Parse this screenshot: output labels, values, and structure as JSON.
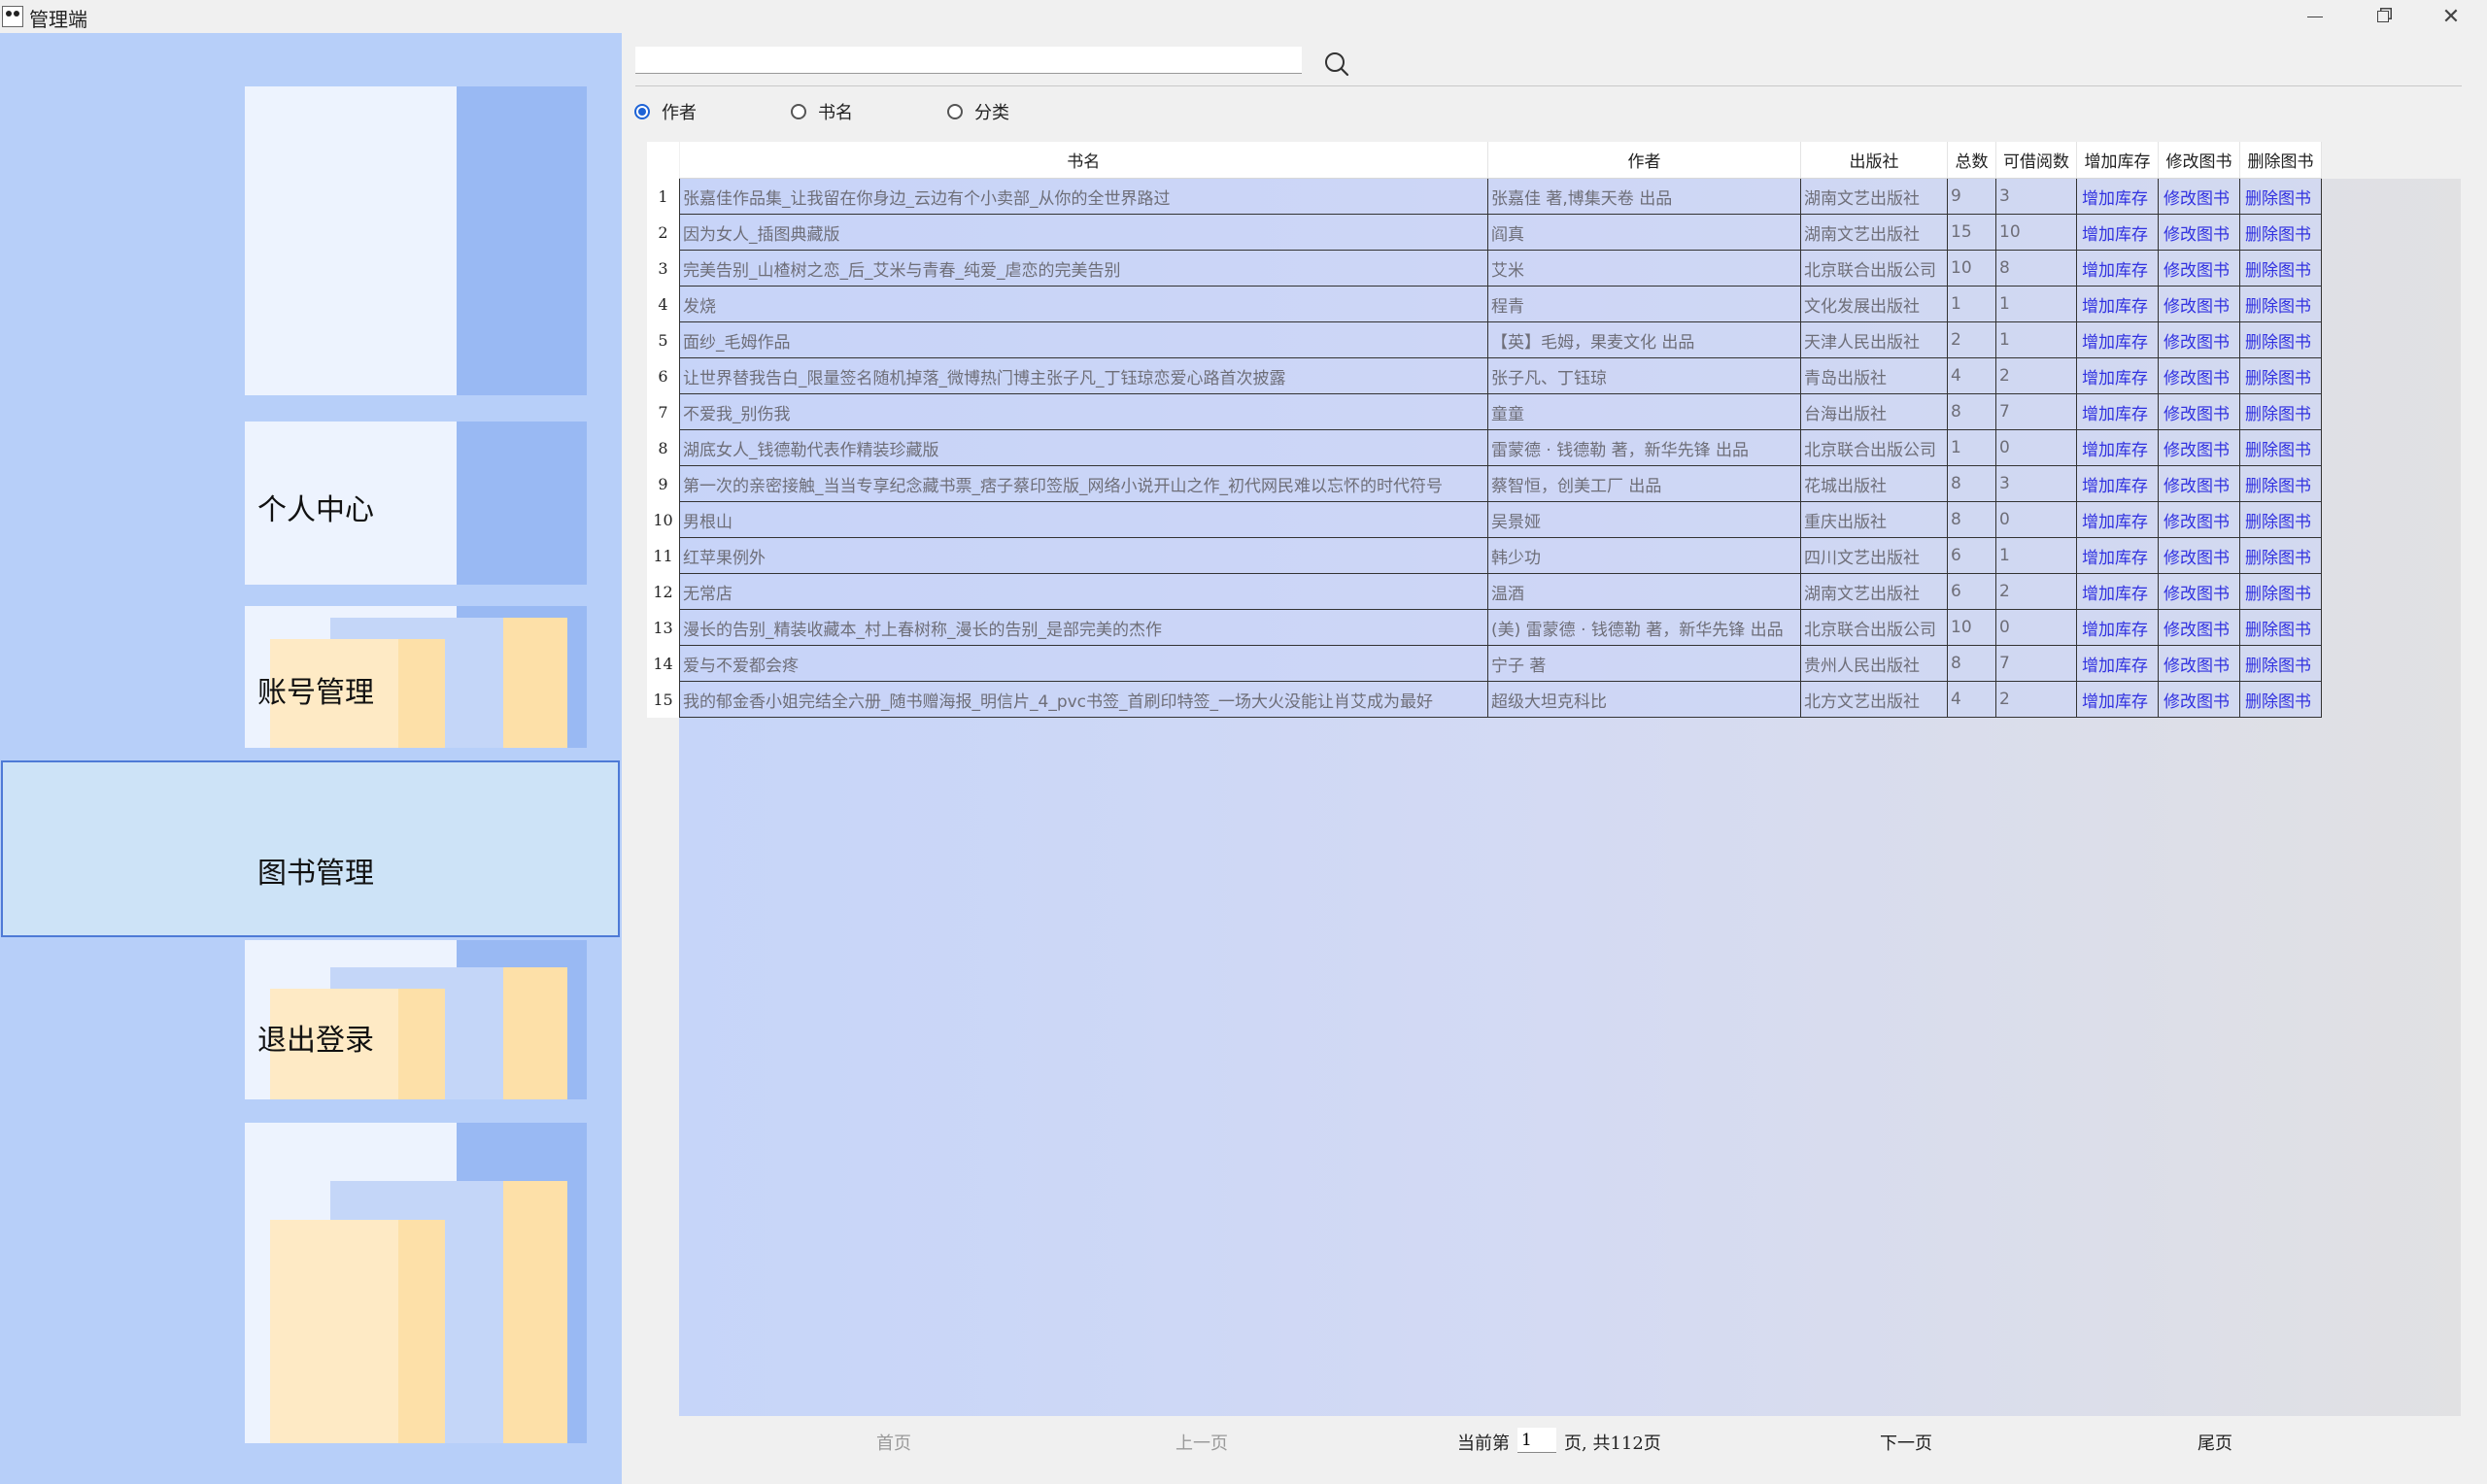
{
  "window": {
    "title": "管理端"
  },
  "sidebar": {
    "items": [
      {
        "label": "个人中心"
      },
      {
        "label": "账号管理"
      },
      {
        "label": "图书管理",
        "active": true
      },
      {
        "label": "退出登录"
      }
    ]
  },
  "search": {
    "value": "",
    "placeholder": ""
  },
  "filters": [
    {
      "label": "作者",
      "checked": true
    },
    {
      "label": "书名",
      "checked": false
    },
    {
      "label": "分类",
      "checked": false
    }
  ],
  "table": {
    "headers": [
      "书名",
      "作者",
      "出版社",
      "总数",
      "可借阅数",
      "增加库存",
      "修改图书",
      "删除图书"
    ],
    "rows": [
      [
        "张嘉佳作品集_让我留在你身边_云边有个小卖部_从你的全世界路过",
        "张嘉佳 著,博集天卷 出品",
        "湖南文艺出版社",
        "9",
        "3"
      ],
      [
        "因为女人_插图典藏版",
        "阎真",
        "湖南文艺出版社",
        "15",
        "10"
      ],
      [
        "完美告别_山楂树之恋_后_艾米与青春_纯爱_虐恋的完美告别",
        "艾米",
        "北京联合出版公司",
        "10",
        "8"
      ],
      [
        "发烧",
        "程青",
        "文化发展出版社",
        "1",
        "1"
      ],
      [
        "面纱_毛姆作品",
        "【英】毛姆，果麦文化 出品",
        "天津人民出版社",
        "2",
        "1"
      ],
      [
        "让世界替我告白_限量签名随机掉落_微博热门博主张子凡_丁钰琼恋爱心路首次披露",
        "张子凡、丁钰琼",
        "青岛出版社",
        "4",
        "2"
      ],
      [
        "不爱我_别伤我",
        "童童",
        "台海出版社",
        "8",
        "7"
      ],
      [
        "湖底女人_钱德勒代表作精装珍藏版",
        "雷蒙德 · 钱德勒 著，新华先锋 出品",
        "北京联合出版公司",
        "1",
        "0"
      ],
      [
        "第一次的亲密接触_当当专享纪念藏书票_痞子蔡印签版_网络小说开山之作_初代网民难以忘怀的时代符号",
        "蔡智恒，创美工厂 出品",
        "花城出版社",
        "8",
        "3"
      ],
      [
        "男根山",
        "吴景娅",
        "重庆出版社",
        "8",
        "0"
      ],
      [
        "红苹果例外",
        "韩少功",
        "四川文艺出版社",
        "6",
        "1"
      ],
      [
        "无常店",
        "温酒",
        "湖南文艺出版社",
        "6",
        "2"
      ],
      [
        "漫长的告别_精装收藏本_村上春树称_漫长的告别_是部完美的杰作",
        "(美) 雷蒙德 · 钱德勒 著，新华先锋 出品",
        "北京联合出版公司",
        "10",
        "0"
      ],
      [
        "爱与不爱都会疼",
        "宁子 著",
        "贵州人民出版社",
        "8",
        "7"
      ],
      [
        "我的郁金香小姐完结全六册_随书赠海报_明信片_4_pvc书签_首刷印特签_一场大火没能让肖艾成为最好",
        "超级大坦克科比",
        "北方文艺出版社",
        "4",
        "2"
      ]
    ],
    "actions": {
      "add": "增加库存",
      "edit": "修改图书",
      "delete": "删除图书"
    }
  },
  "pager": {
    "first": "首页",
    "prev": "上一页",
    "current_prefix": "当前第",
    "current_page": "1",
    "total_suffix": "页, 共112页",
    "next": "下一页",
    "last": "尾页"
  },
  "colors": {
    "sidebar_bg": "#b7cff9",
    "active_item_bg": "#cde3f7",
    "active_border": "#4e7ad6",
    "action_link": "#3131e0",
    "radio_checked": "#1e63d6"
  }
}
